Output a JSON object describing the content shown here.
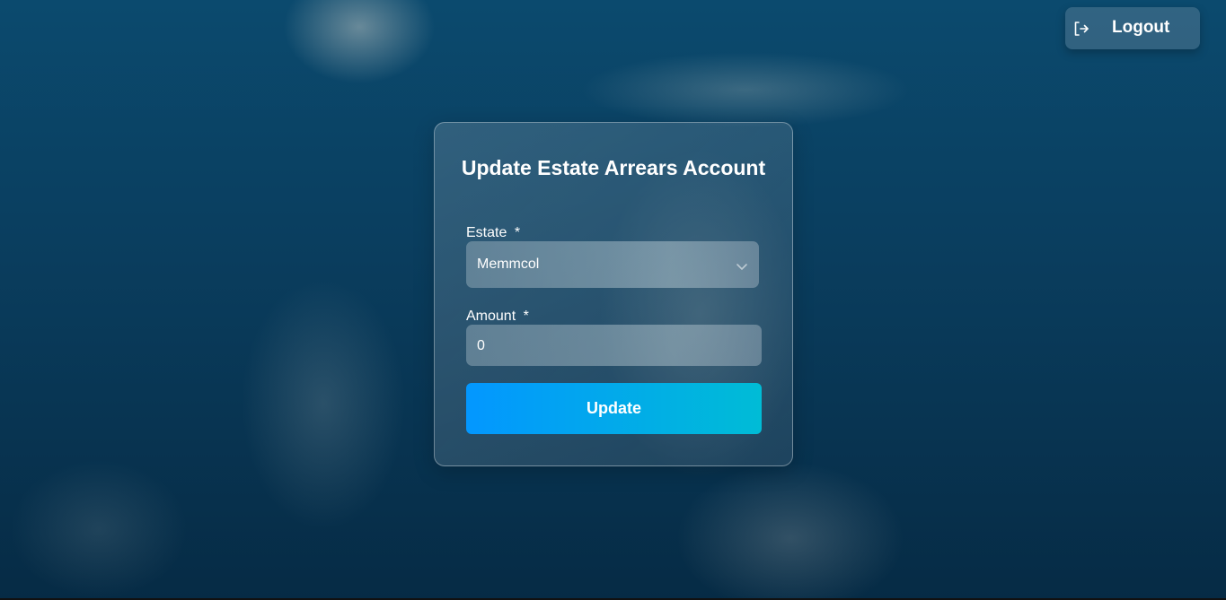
{
  "header": {
    "logout": {
      "label": "Logout",
      "icon": "logout-icon"
    }
  },
  "form": {
    "title": "Update Estate Arrears Account",
    "estate": {
      "label": "Estate",
      "required_marker": "*",
      "value": "Memmcol",
      "icon": "chevron-down-icon"
    },
    "amount": {
      "label": "Amount",
      "required_marker": "*",
      "value": "0"
    },
    "submit_label": "Update"
  },
  "colors": {
    "background": "#0a3e5f",
    "button_gradient_start": "#0397ff",
    "button_gradient_end": "#00bcd6"
  }
}
